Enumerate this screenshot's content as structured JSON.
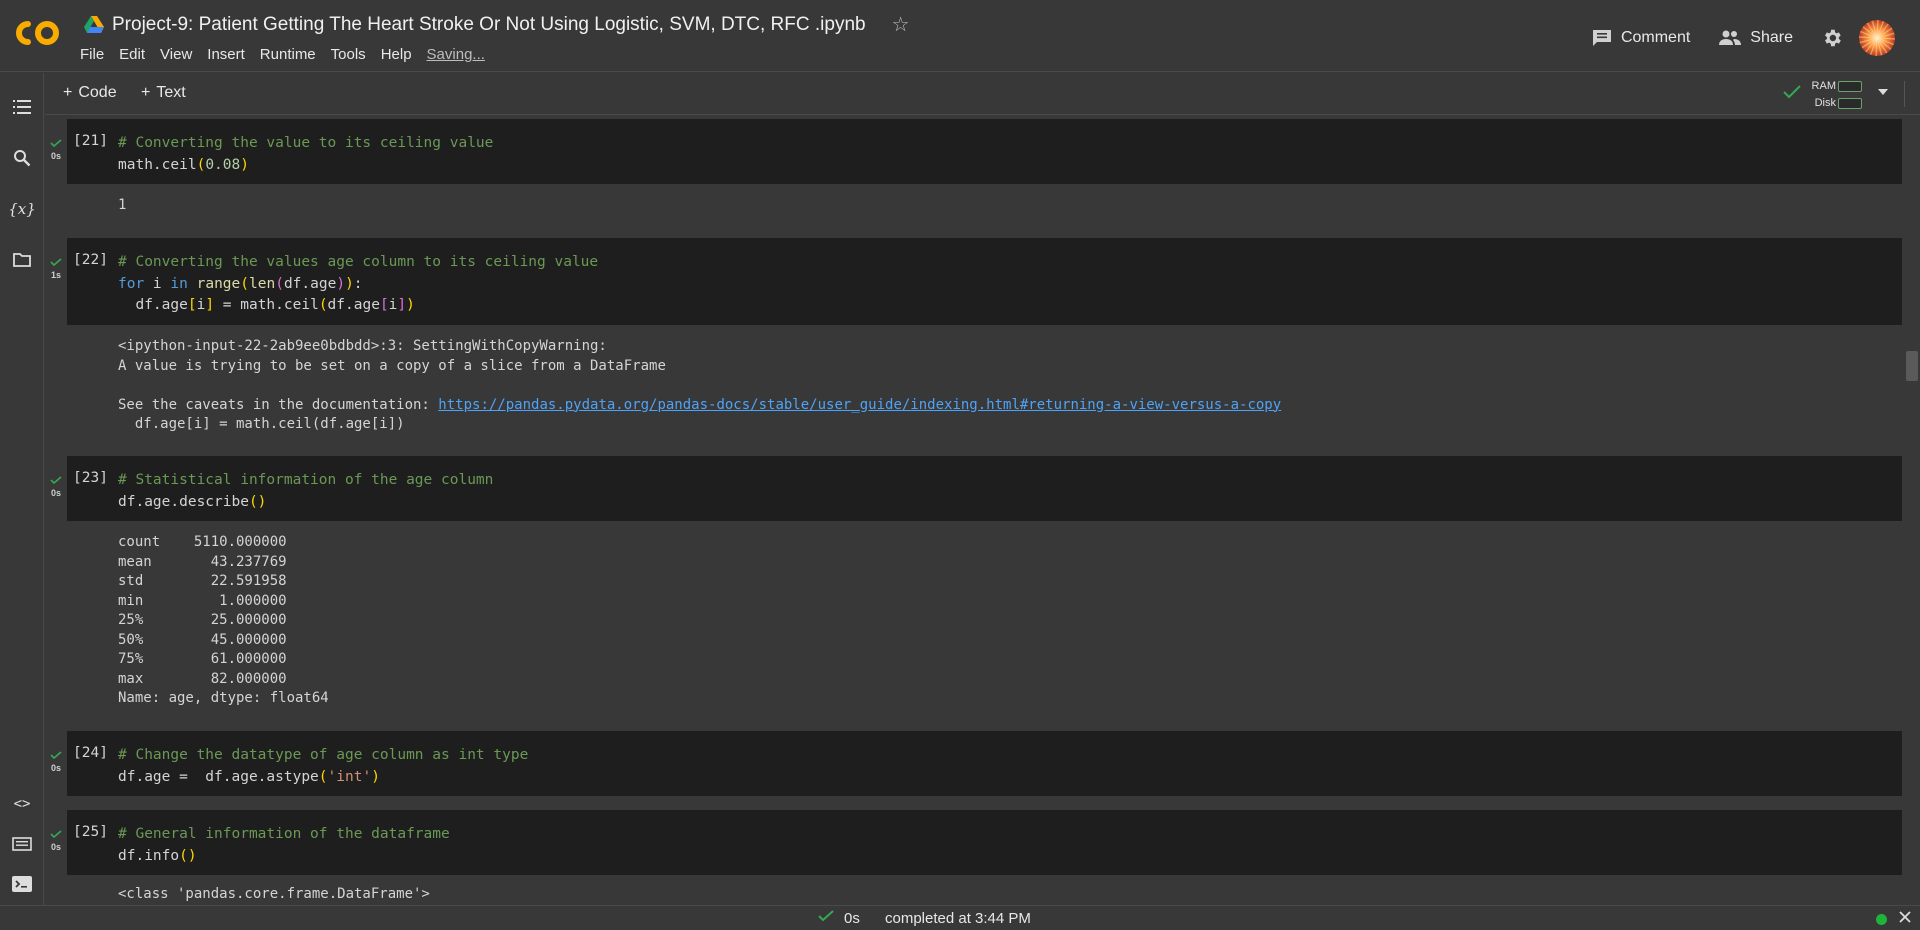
{
  "header": {
    "title": "Project-9: Patient Getting The Heart Stroke Or Not Using Logistic,  SVM, DTC, RFC .ipynb",
    "menu": [
      "File",
      "Edit",
      "View",
      "Insert",
      "Runtime",
      "Tools",
      "Help"
    ],
    "saving": "Saving...",
    "comment_label": "Comment",
    "share_label": "Share"
  },
  "toolbar": {
    "code_label": "Code",
    "text_label": "Text",
    "ram_label": "RAM",
    "disk_label": "Disk"
  },
  "cells": [
    {
      "exec_count": "[21]",
      "time": "0s",
      "comment": "# Converting the value to its ceiling value",
      "out_lines": [
        "1"
      ]
    },
    {
      "exec_count": "[22]",
      "time": "1s",
      "comment": "# Converting the values age column to its ceiling value",
      "out_lines": [
        "<ipython-input-22-2ab9ee0bdbdd>:3: SettingWithCopyWarning:",
        "A value is trying to be set on a copy of a slice from a DataFrame",
        "",
        "See the caveats in the documentation: ",
        "  df.age[i] = math.ceil(df.age[i])"
      ],
      "link": "https://pandas.pydata.org/pandas-docs/stable/user_guide/indexing.html#returning-a-view-versus-a-copy"
    },
    {
      "exec_count": "[23]",
      "time": "0s",
      "comment": "# Statistical information of the age column",
      "out_lines": [
        "count    5110.000000",
        "mean       43.237769",
        "std        22.591958",
        "min         1.000000",
        "25%        25.000000",
        "50%        45.000000",
        "75%        61.000000",
        "max        82.000000",
        "Name: age, dtype: float64"
      ]
    },
    {
      "exec_count": "[24]",
      "time": "0s",
      "comment": "# Change the datatype of age column as int type"
    },
    {
      "exec_count": "[25]",
      "time": "0s",
      "comment": "# General information of the dataframe",
      "out_lines": [
        "<class 'pandas.core.frame.DataFrame'>"
      ]
    }
  ],
  "status": {
    "time": "0s",
    "message": "completed at 3:44 PM"
  },
  "colors": {
    "accent_orange": "#f9ab00",
    "success_green": "#34a853",
    "comment_green": "#6a9955",
    "keyword_blue": "#569cd6",
    "link_blue": "#4fa3f7"
  }
}
